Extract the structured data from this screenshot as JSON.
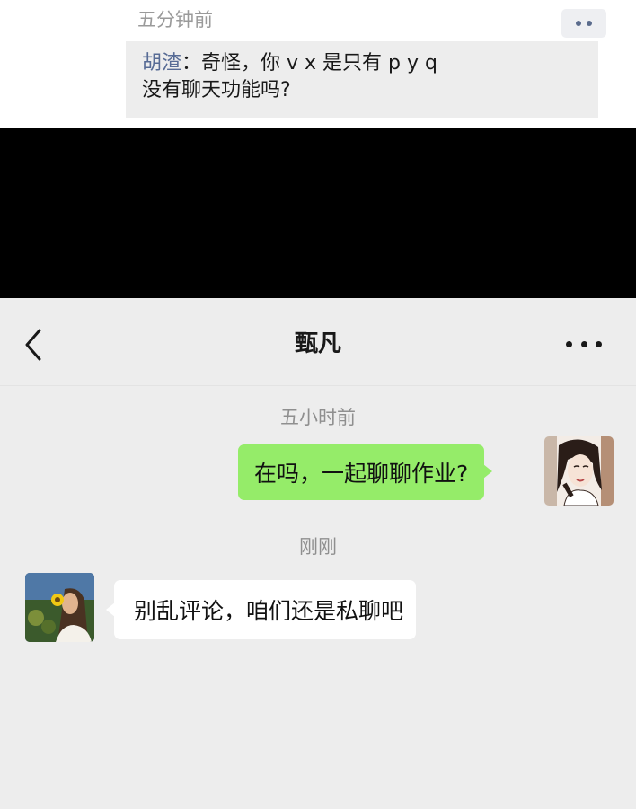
{
  "moments": {
    "time": "五分钟前",
    "more_button": "more-dots-icon",
    "comment": {
      "author": "胡渣",
      "separator": "：",
      "line1": "奇怪，你 v x 是只有 p y q",
      "line2": "没有聊天功能吗?"
    }
  },
  "chat": {
    "title": "甄凡",
    "back_icon": "chevron-left-icon",
    "more_icon": "more-horizontal-icon",
    "messages": [
      {
        "time": "五小时前",
        "sender": "me",
        "text": "在吗，一起聊聊作业?"
      },
      {
        "time": "刚刚",
        "sender": "other",
        "text": "别乱评论，咱们还是私聊吧"
      }
    ]
  },
  "colors": {
    "chat_bg": "#ededed",
    "my_bubble": "#95ec69",
    "other_bubble": "#ffffff",
    "author_link": "#576b95"
  }
}
